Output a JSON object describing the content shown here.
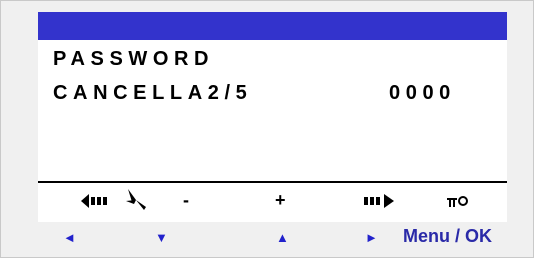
{
  "lcd": {
    "line1": "PASSWORD",
    "line2_label": "CANCELLA2/5",
    "line2_value": "0000"
  },
  "function_keys": [
    {
      "name": "scroll-left-icon",
      "glyph": "◀▮▮▮"
    },
    {
      "name": "fan-icon",
      "glyph": "✤"
    },
    {
      "name": "minus-key",
      "glyph": "-"
    },
    {
      "name": "plus-key",
      "glyph": "+"
    },
    {
      "name": "scroll-right-icon",
      "glyph": "▮▮▮▶"
    },
    {
      "name": "key-icon",
      "glyph": "πO"
    }
  ],
  "nav_buttons": [
    {
      "name": "left-arrow-button",
      "glyph": "◄"
    },
    {
      "name": "down-arrow-button",
      "glyph": "▼"
    },
    {
      "name": "up-arrow-button",
      "glyph": "▲"
    },
    {
      "name": "right-arrow-button",
      "glyph": "►"
    }
  ],
  "menu_ok_label": "Menu / OK",
  "colors": {
    "title_bar": "#3333cc",
    "nav_blue": "#2222cc",
    "menu_ok": "#2a2aa8"
  }
}
